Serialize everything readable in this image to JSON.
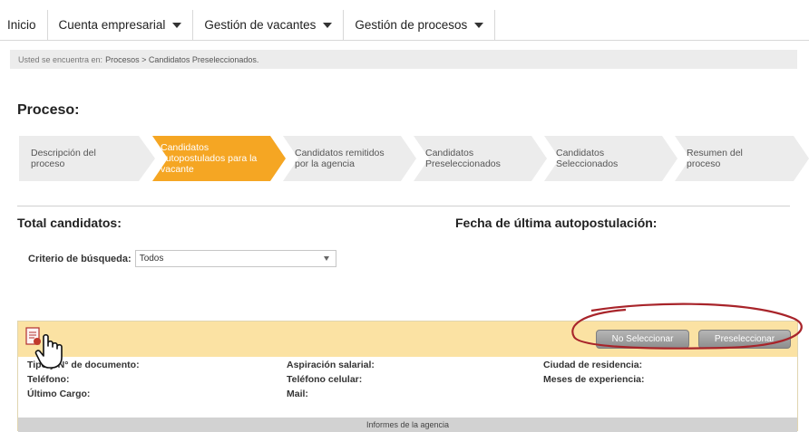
{
  "nav": {
    "items": [
      {
        "label": "Inicio",
        "dropdown": false
      },
      {
        "label": "Cuenta empresarial",
        "dropdown": true
      },
      {
        "label": "Gestión de vacantes",
        "dropdown": true
      },
      {
        "label": "Gestión de procesos",
        "dropdown": true
      }
    ]
  },
  "breadcrumb": {
    "prefix": "Usted se encuentra en:",
    "path": "Procesos > Candidatos Preseleccionados."
  },
  "page": {
    "title": "Proceso:"
  },
  "steps": [
    {
      "line1": "Descripción del",
      "line2": "proceso",
      "line3": "",
      "active": false
    },
    {
      "line1": "Candidatos",
      "line2": "autopostulados para la",
      "line3": "vacante",
      "active": true
    },
    {
      "line1": "Candidatos remitidos",
      "line2": "por la agencia",
      "line3": "",
      "active": false
    },
    {
      "line1": "Candidatos",
      "line2": "Preseleccionados",
      "line3": "",
      "active": false
    },
    {
      "line1": "Candidatos",
      "line2": "Seleccionados",
      "line3": "",
      "active": false
    },
    {
      "line1": "Resumen del",
      "line2": "proceso",
      "line3": "",
      "active": false
    }
  ],
  "summary": {
    "total_label": "Total candidatos:",
    "fecha_label": "Fecha de última autopostulación:"
  },
  "search": {
    "label": "Criterio de búsqueda:",
    "selected": "Todos"
  },
  "candidate": {
    "buttons": {
      "no_select": "No Seleccionar",
      "preselect": "Preseleccionar"
    },
    "fields": {
      "doc_type": "Tipo y N° de documento:",
      "phone": "Teléfono:",
      "last_job": "Último Cargo:",
      "salary": "Aspiración salarial:",
      "cell": "Teléfono celular:",
      "mail": "Mail:",
      "city": "Ciudad de residencia:",
      "experience": "Meses de experiencia:"
    },
    "informes": "Informes de la agencia"
  },
  "colors": {
    "active_step": "#f5a623",
    "inactive_step": "#ececec",
    "card_header": "#fbe2a3",
    "annotation": "#a8242a"
  },
  "icons": [
    "document-icon",
    "pointer-hand-icon",
    "chevron-down-icon"
  ]
}
